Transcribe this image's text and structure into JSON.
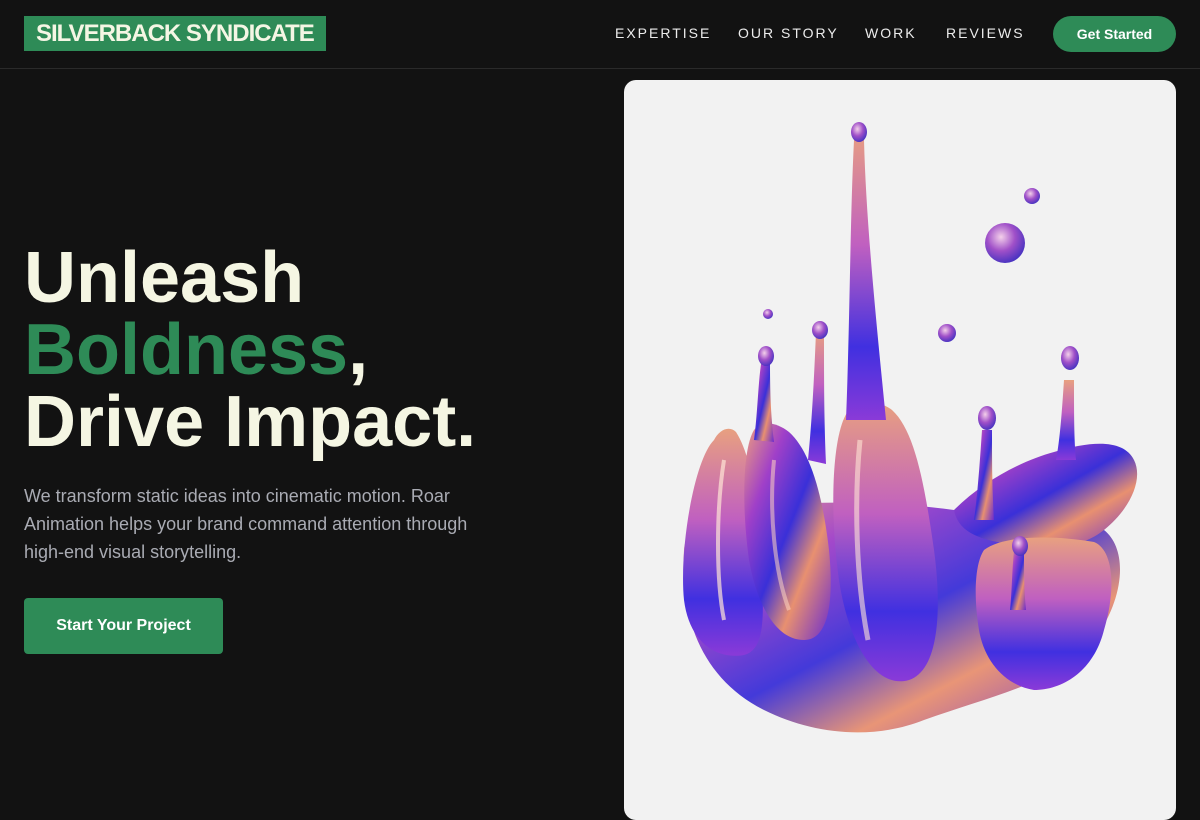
{
  "brand": {
    "name": "SILVERBACK SYNDICATE",
    "accent": "#2e8b57",
    "background": "#121212",
    "headline_color": "#f5f6e3"
  },
  "nav": {
    "items": [
      {
        "label": "EXPERTISE"
      },
      {
        "label": "OUR STORY"
      },
      {
        "label": "WORK"
      },
      {
        "label": "REVIEWS"
      }
    ],
    "cta": "Get Started"
  },
  "hero": {
    "title_line1": "Unleash",
    "title_accent": "Boldness",
    "title_comma": ",",
    "title_line3": "Drive Impact.",
    "description": "We transform static ideas into cinematic motion. Roar Animation helps your brand command attention through high-end visual storytelling.",
    "cta": "Start Your Project"
  },
  "visual": {
    "icon": "iridescent-liquid-splash-image"
  }
}
